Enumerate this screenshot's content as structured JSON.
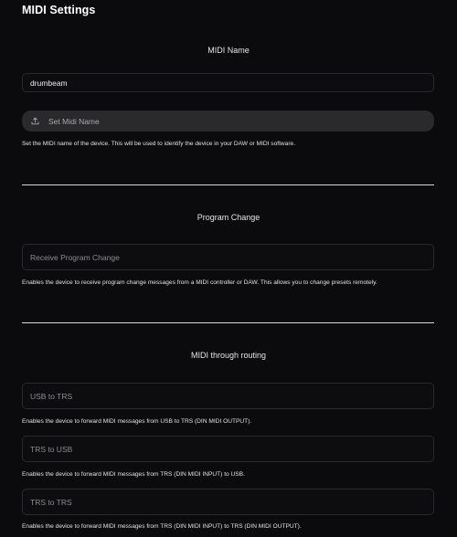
{
  "page": {
    "title": "MIDI Settings"
  },
  "midi_name": {
    "heading": "MIDI Name",
    "input_value": "drumbeam",
    "set_button_label": "Set Midi Name",
    "set_button_icon": "upload-icon",
    "help": "Set the MIDI name of the device. This will be used to identify the device in your DAW or MIDI software."
  },
  "program_change": {
    "heading": "Program Change",
    "field_label": "Receive Program Change",
    "help": "Enables the device to receive program change messages from a MIDI controller or DAW. This allows you to change presets remotely."
  },
  "midi_through": {
    "heading": "MIDI through routing",
    "routes": [
      {
        "label": "USB to TRS",
        "help": "Enables the device to forward MIDI messages from USB to TRS (DIN MIDI OUTPUT)."
      },
      {
        "label": "TRS to USB",
        "help": "Enables the device to forward MIDI messages from TRS (DIN MIDI INPUT) to USB."
      },
      {
        "label": "TRS to TRS",
        "help": "Enables the device to forward MIDI messages from TRS (DIN MIDI INPUT) to TRS (DIN MIDI OUTPUT)."
      }
    ]
  },
  "colors": {
    "background": "#0b0b0d",
    "field_border": "#2a2a2e",
    "button_bg": "#2a2a2d",
    "divider": "#d9d9d9"
  }
}
